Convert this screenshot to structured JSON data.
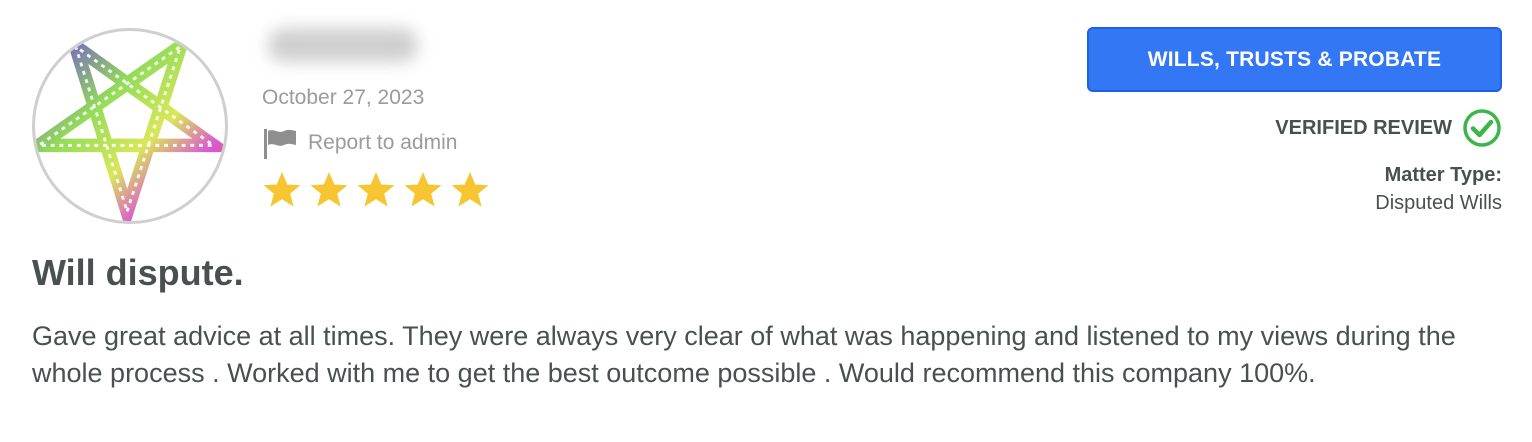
{
  "reviewer": {
    "avatar_icon": "pentagram-logo-icon",
    "name": "",
    "date": "October 27, 2023",
    "report_label": "Report to admin",
    "rating": 5,
    "rating_max": 5
  },
  "category": {
    "label": "WILLS, TRUSTS & PROBATE"
  },
  "verification": {
    "label": "VERIFIED REVIEW",
    "icon": "check-circle-icon"
  },
  "matter": {
    "label": "Matter Type:",
    "value": "Disputed Wills"
  },
  "review": {
    "title": "Will dispute.",
    "body": "Gave great advice at all times. They were always very clear of what was happening and listened to my views during the whole process . Worked with me to get the best outcome possible . Would recommend this company 100%."
  },
  "colors": {
    "accent": "#3477f5",
    "star": "#f7c531",
    "verified_green": "#3cb54a",
    "text": "#4a4f4f",
    "muted": "#9b9b9b"
  }
}
